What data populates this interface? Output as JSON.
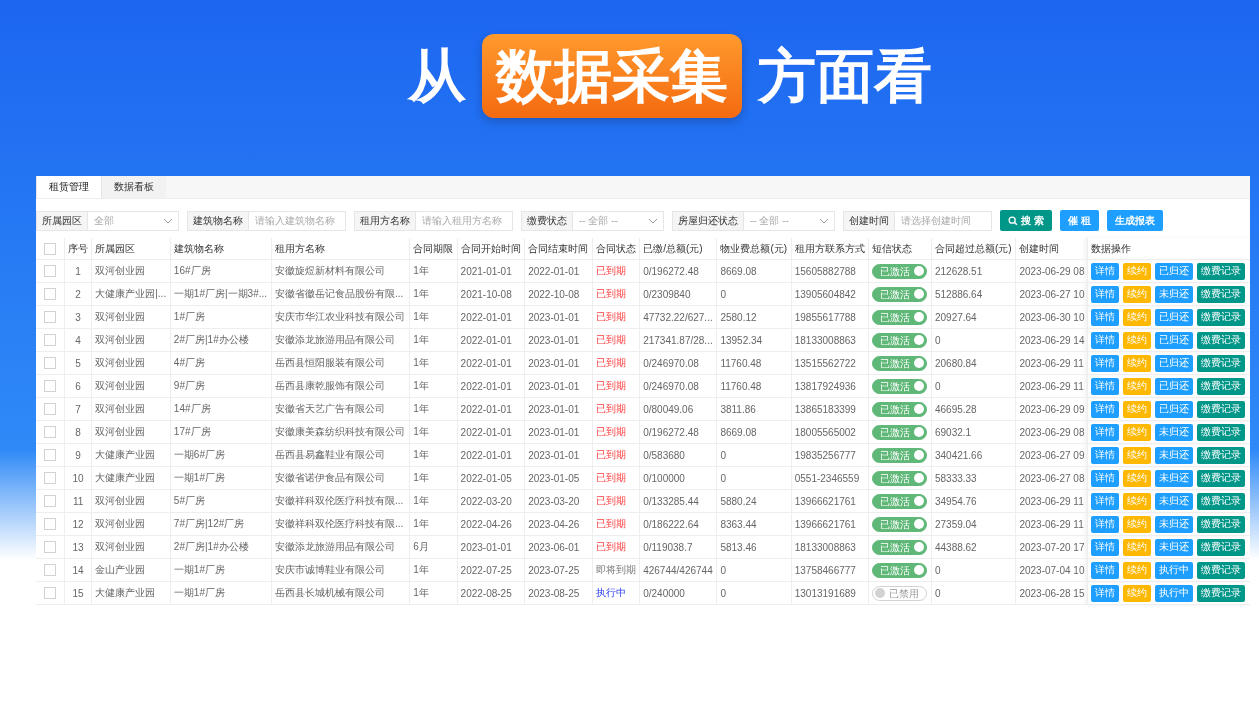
{
  "headline": {
    "before": "从",
    "highlight": "数据采集",
    "after": "方面看"
  },
  "tabs": [
    {
      "label": "租赁管理",
      "selected": true
    },
    {
      "label": "数据看板",
      "selected": false
    }
  ],
  "filters": [
    {
      "label": "所属园区",
      "kind": "select",
      "placeholder": "全部"
    },
    {
      "label": "建筑物名称",
      "kind": "text",
      "placeholder": "请输入建筑物名称"
    },
    {
      "label": "租用方名称",
      "kind": "text",
      "placeholder": "请输入租用方名称"
    },
    {
      "label": "缴费状态",
      "kind": "select",
      "placeholder": "-- 全部 --"
    },
    {
      "label": "房屋归还状态",
      "kind": "select",
      "placeholder": "-- 全部 --"
    },
    {
      "label": "创建时间",
      "kind": "text",
      "placeholder": "请选择创建时间"
    }
  ],
  "toolbar_buttons": [
    {
      "label": "搜 索",
      "kind": "search"
    },
    {
      "label": "催 租",
      "kind": "primary"
    },
    {
      "label": "生成报表",
      "kind": "primary"
    }
  ],
  "table": {
    "select_all_checked": false,
    "columns": [
      "序号",
      "所属园区",
      "建筑物名称",
      "租用方名称",
      "合同期限",
      "合同开始时间",
      "合同结束时间",
      "合同状态",
      "已缴/总额(元)",
      "物业费总额(元)",
      "租用方联系方式",
      "短信状态",
      "合同超过总额(元)",
      "创建时间",
      "数据操作"
    ],
    "rows": [
      {
        "checked": false,
        "no": "1",
        "park": "双河创业园",
        "building": "16#厂房",
        "tenant": "安徽旋煜新材料有限公司",
        "term": "1年",
        "start": "2021-01-01",
        "end": "2022-01-01",
        "status": {
          "text": "已到期",
          "kind": "expired"
        },
        "paid": "0/196272.48",
        "property_fee": "8669.08",
        "phone": "15605882788",
        "sms": {
          "on": true,
          "label": "已激活"
        },
        "overdue": "212628.51",
        "created": "2023-06-29 08",
        "actions": [
          "详情",
          "续约",
          "已归还",
          "缴费记录"
        ]
      },
      {
        "checked": false,
        "no": "2",
        "park": "大健康产业园|...",
        "building": "一期1#厂房|一期3#...",
        "tenant": "安徽省徽岳记食品股份有限...",
        "term": "1年",
        "start": "2021-10-08",
        "end": "2022-10-08",
        "status": {
          "text": "已到期",
          "kind": "expired"
        },
        "paid": "0/2309840",
        "property_fee": "0",
        "phone": "13905604842",
        "sms": {
          "on": true,
          "label": "已激活"
        },
        "overdue": "512886.64",
        "created": "2023-06-27 10",
        "actions": [
          "详情",
          "续约",
          "未归还",
          "缴费记录"
        ]
      },
      {
        "checked": false,
        "no": "3",
        "park": "双河创业园",
        "building": "1#厂房",
        "tenant": "安庆市华江农业科技有限公司",
        "term": "1年",
        "start": "2022-01-01",
        "end": "2023-01-01",
        "status": {
          "text": "已到期",
          "kind": "expired"
        },
        "paid": "47732.22/627...",
        "property_fee": "2580.12",
        "phone": "19855617788",
        "sms": {
          "on": true,
          "label": "已激活"
        },
        "overdue": "20927.64",
        "created": "2023-06-30 10",
        "actions": [
          "详情",
          "续约",
          "已归还",
          "缴费记录"
        ]
      },
      {
        "checked": false,
        "no": "4",
        "park": "双河创业园",
        "building": "2#厂房|1#办公楼",
        "tenant": "安徽添龙旅游用品有限公司",
        "term": "1年",
        "start": "2022-01-01",
        "end": "2023-01-01",
        "status": {
          "text": "已到期",
          "kind": "expired"
        },
        "paid": "217341.87/28...",
        "property_fee": "13952.34",
        "phone": "18133008863",
        "sms": {
          "on": true,
          "label": "已激活"
        },
        "overdue": "0",
        "created": "2023-06-29 14",
        "actions": [
          "详情",
          "续约",
          "已归还",
          "缴费记录"
        ]
      },
      {
        "checked": false,
        "no": "5",
        "park": "双河创业园",
        "building": "4#厂房",
        "tenant": "岳西县恒阳服装有限公司",
        "term": "1年",
        "start": "2022-01-01",
        "end": "2023-01-01",
        "status": {
          "text": "已到期",
          "kind": "expired"
        },
        "paid": "0/246970.08",
        "property_fee": "11760.48",
        "phone": "13515562722",
        "sms": {
          "on": true,
          "label": "已激活"
        },
        "overdue": "20680.84",
        "created": "2023-06-29 11",
        "actions": [
          "详情",
          "续约",
          "已归还",
          "缴费记录"
        ]
      },
      {
        "checked": false,
        "no": "6",
        "park": "双河创业园",
        "building": "9#厂房",
        "tenant": "岳西县康乾服饰有限公司",
        "term": "1年",
        "start": "2022-01-01",
        "end": "2023-01-01",
        "status": {
          "text": "已到期",
          "kind": "expired"
        },
        "paid": "0/246970.08",
        "property_fee": "11760.48",
        "phone": "13817924936",
        "sms": {
          "on": true,
          "label": "已激活"
        },
        "overdue": "0",
        "created": "2023-06-29 11",
        "actions": [
          "详情",
          "续约",
          "已归还",
          "缴费记录"
        ]
      },
      {
        "checked": false,
        "no": "7",
        "park": "双河创业园",
        "building": "14#厂房",
        "tenant": "安徽省天艺广告有限公司",
        "term": "1年",
        "start": "2022-01-01",
        "end": "2023-01-01",
        "status": {
          "text": "已到期",
          "kind": "expired"
        },
        "paid": "0/80049.06",
        "property_fee": "3811.86",
        "phone": "13865183399",
        "sms": {
          "on": true,
          "label": "已激活"
        },
        "overdue": "46695.28",
        "created": "2023-06-29 09",
        "actions": [
          "详情",
          "续约",
          "已归还",
          "缴费记录"
        ]
      },
      {
        "checked": false,
        "no": "8",
        "park": "双河创业园",
        "building": "17#厂房",
        "tenant": "安徽康美森纺织科技有限公司",
        "term": "1年",
        "start": "2022-01-01",
        "end": "2023-01-01",
        "status": {
          "text": "已到期",
          "kind": "expired"
        },
        "paid": "0/196272.48",
        "property_fee": "8669.08",
        "phone": "18005565002",
        "sms": {
          "on": true,
          "label": "已激活"
        },
        "overdue": "69032.1",
        "created": "2023-06-29 08",
        "actions": [
          "详情",
          "续约",
          "未归还",
          "缴费记录"
        ]
      },
      {
        "checked": false,
        "no": "9",
        "park": "大健康产业园",
        "building": "一期6#厂房",
        "tenant": "岳西县易鑫鞋业有限公司",
        "term": "1年",
        "start": "2022-01-01",
        "end": "2023-01-01",
        "status": {
          "text": "已到期",
          "kind": "expired"
        },
        "paid": "0/583680",
        "property_fee": "0",
        "phone": "19835256777",
        "sms": {
          "on": true,
          "label": "已激活"
        },
        "overdue": "340421.66",
        "created": "2023-06-27 09",
        "actions": [
          "详情",
          "续约",
          "未归还",
          "缴费记录"
        ]
      },
      {
        "checked": false,
        "no": "10",
        "park": "大健康产业园",
        "building": "一期1#厂房",
        "tenant": "安徽省诺伊食品有限公司",
        "term": "1年",
        "start": "2022-01-05",
        "end": "2023-01-05",
        "status": {
          "text": "已到期",
          "kind": "expired"
        },
        "paid": "0/100000",
        "property_fee": "0",
        "phone": "0551-2346559",
        "sms": {
          "on": true,
          "label": "已激活"
        },
        "overdue": "58333.33",
        "created": "2023-06-27 08",
        "actions": [
          "详情",
          "续约",
          "未归还",
          "缴费记录"
        ]
      },
      {
        "checked": false,
        "no": "11",
        "park": "双河创业园",
        "building": "5#厂房",
        "tenant": "安徽祥科双伦医疗科技有限...",
        "term": "1年",
        "start": "2022-03-20",
        "end": "2023-03-20",
        "status": {
          "text": "已到期",
          "kind": "expired"
        },
        "paid": "0/133285.44",
        "property_fee": "5880.24",
        "phone": "13966621761",
        "sms": {
          "on": true,
          "label": "已激活"
        },
        "overdue": "34954.76",
        "created": "2023-06-29 11",
        "actions": [
          "详情",
          "续约",
          "未归还",
          "缴费记录"
        ]
      },
      {
        "checked": false,
        "no": "12",
        "park": "双河创业园",
        "building": "7#厂房|12#厂房",
        "tenant": "安徽祥科双伦医疗科技有限...",
        "term": "1年",
        "start": "2022-04-26",
        "end": "2023-04-26",
        "status": {
          "text": "已到期",
          "kind": "expired"
        },
        "paid": "0/186222.64",
        "property_fee": "8363.44",
        "phone": "13966621761",
        "sms": {
          "on": true,
          "label": "已激活"
        },
        "overdue": "27359.04",
        "created": "2023-06-29 11",
        "actions": [
          "详情",
          "续约",
          "未归还",
          "缴费记录"
        ]
      },
      {
        "checked": false,
        "no": "13",
        "park": "双河创业园",
        "building": "2#厂房|1#办公楼",
        "tenant": "安徽添龙旅游用品有限公司",
        "term": "6月",
        "start": "2023-01-01",
        "end": "2023-06-01",
        "status": {
          "text": "已到期",
          "kind": "expired"
        },
        "paid": "0/119038.7",
        "property_fee": "5813.46",
        "phone": "18133008863",
        "sms": {
          "on": true,
          "label": "已激活"
        },
        "overdue": "44388.62",
        "created": "2023-07-20 17",
        "actions": [
          "详情",
          "续约",
          "未归还",
          "缴费记录"
        ]
      },
      {
        "checked": false,
        "no": "14",
        "park": "金山产业园",
        "building": "一期1#厂房",
        "tenant": "安庆市诚博鞋业有限公司",
        "term": "1年",
        "start": "2022-07-25",
        "end": "2023-07-25",
        "status": {
          "text": "即将到期",
          "kind": "due"
        },
        "paid": "426744/426744",
        "property_fee": "0",
        "phone": "13758466777",
        "sms": {
          "on": true,
          "label": "已激活"
        },
        "overdue": "0",
        "created": "2023-07-04 10",
        "actions": [
          "详情",
          "续约",
          "执行中",
          "缴费记录"
        ]
      },
      {
        "checked": false,
        "no": "15",
        "park": "大健康产业园",
        "building": "一期1#厂房",
        "tenant": "岳西县长城机械有限公司",
        "term": "1年",
        "start": "2022-08-25",
        "end": "2023-08-25",
        "status": {
          "text": "执行中",
          "kind": "running"
        },
        "paid": "0/240000",
        "property_fee": "0",
        "phone": "13013191689",
        "sms": {
          "on": false,
          "label": "已禁用"
        },
        "overdue": "0",
        "created": "2023-06-28 15",
        "actions": [
          "详情",
          "续约",
          "执行中",
          "缴费记录"
        ]
      }
    ]
  }
}
